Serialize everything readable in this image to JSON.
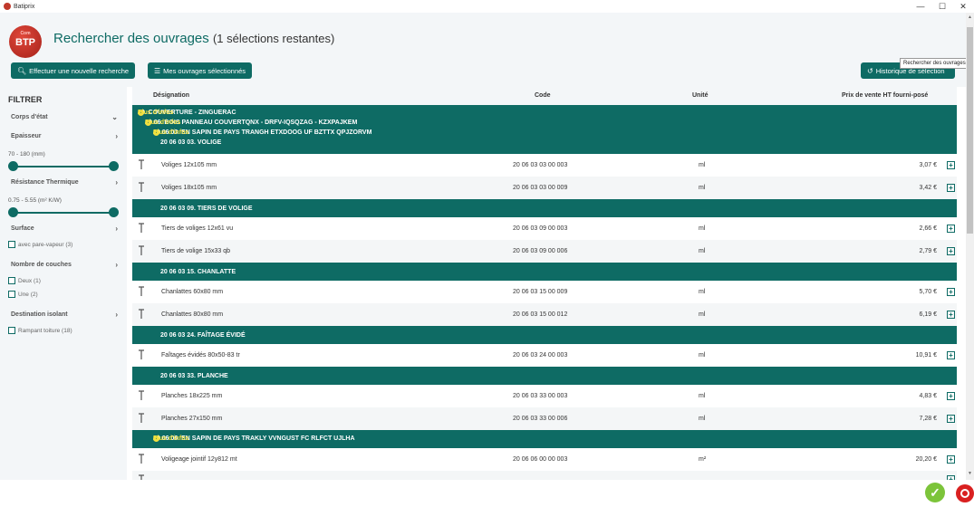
{
  "window": {
    "title": "Batiprix",
    "controls": [
      "—",
      "☐",
      "✕"
    ]
  },
  "header": {
    "logo": {
      "text": "BTP",
      "small": "Com"
    },
    "title": "Rechercher des ouvrages",
    "subtitle": "(1 sélections restantes)",
    "buttons": {
      "new_search": "Effectuer une nouvelle recherche",
      "my_selection": "Mes ouvrages sélectionnés",
      "history": "Historique de sélection"
    },
    "tooltip": "Rechercher des ouvrages"
  },
  "filters": {
    "title": "FILTRER",
    "corps": "Corps d'état",
    "epaisseur": "Epaisseur",
    "epaisseur_range": "70 - 180  (mm)",
    "resistance": "Résistance Thermique",
    "resistance_range": "0.75 - 5.55  (m² K/W)",
    "surface": "Surface",
    "surface_opt": "avec pare-vapeur (3)",
    "couches": "Nombre de couches",
    "couches_opt1": "Deux (1)",
    "couches_opt2": "Une (2)",
    "destination": "Destination isolant",
    "destination_opt": "Rampant toiture (18)"
  },
  "table": {
    "columns": {
      "designation": "Désignation",
      "code": "Code",
      "unit": "Unité",
      "price": "Prix de vente HT fourni-posé"
    },
    "more_info": "Plus d'infos",
    "groups": {
      "g1": "20. COUVERTURE - ZINGUERAC",
      "g2": "20 06. BOIS PANNEAU COUVERTQNX - DRFV-IQSQZAG - KZXPAJKEM",
      "g3": "20 06 03. EN SAPIN DE PAYS TRANGH ETXDOOG UF BZTTX QPJZORVM",
      "g4": "20 06 03 03. VOLIGE",
      "g5": "20 06 03 09. TIERS DE VOLIGE",
      "g6": "20 06 03 15. CHANLATTE",
      "g7": "20 06 03 24. FAÎTAGE ÉVIDÉ",
      "g8": "20 06 03 33. PLANCHE",
      "g9": "20 06 06. EN SAPIN DE PAYS TRAKLY VVNGUST FC RLFCT UJLHA"
    },
    "rows": [
      {
        "name": "Voliges 12x105 mm",
        "code": "20 06 03 03 00 003",
        "unit": "ml",
        "price": "3,07 €"
      },
      {
        "name": "Voliges 18x105 mm",
        "code": "20 06 03 03 00 009",
        "unit": "ml",
        "price": "3,42 €"
      },
      {
        "name": "Tiers de voliges 12x61 vu",
        "code": "20 06 03 09 00 003",
        "unit": "ml",
        "price": "2,66 €"
      },
      {
        "name": "Tiers de volige 15x33 qb",
        "code": "20 06 03 09 00 006",
        "unit": "ml",
        "price": "2,79 €"
      },
      {
        "name": "Chanlattes 60x80 mm",
        "code": "20 06 03 15 00 009",
        "unit": "ml",
        "price": "5,70 €"
      },
      {
        "name": "Chanlattes 80x80 mm",
        "code": "20 06 03 15 00 012",
        "unit": "ml",
        "price": "6,19 €"
      },
      {
        "name": "Faîtages évidés 80x50-83 tr",
        "code": "20 06 03 24 00 003",
        "unit": "ml",
        "price": "10,91 €"
      },
      {
        "name": "Planches 18x225 mm",
        "code": "20 06 03 33 00 003",
        "unit": "ml",
        "price": "4,83 €"
      },
      {
        "name": "Planches 27x150 mm",
        "code": "20 06 03 33 00 006",
        "unit": "ml",
        "price": "7,28 €"
      },
      {
        "name": "Voligeage jointif 12y812 mt",
        "code": "20 06 06 00 00 003",
        "unit": "m²",
        "price": "20,20 €"
      }
    ]
  },
  "footer": {
    "ok": "✓"
  }
}
